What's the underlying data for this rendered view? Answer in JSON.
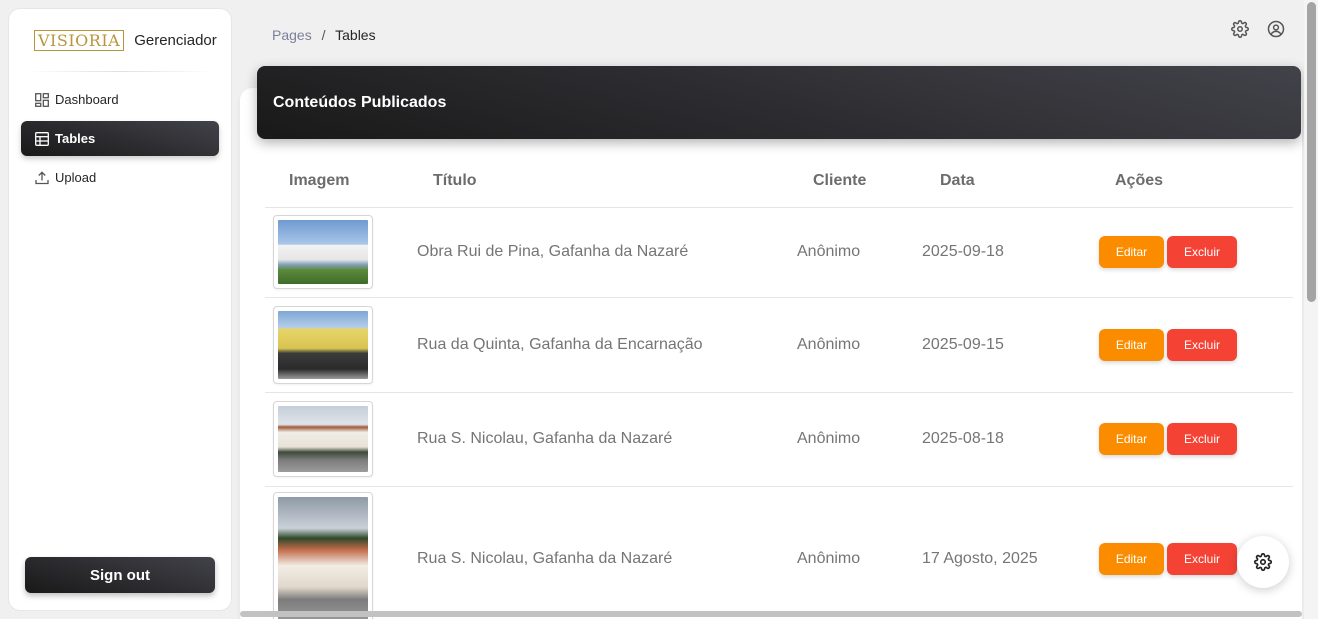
{
  "sidebar": {
    "logo_text": "VISIORIA",
    "brand_name": "Gerenciador",
    "items": [
      {
        "label": "Dashboard",
        "icon": "dashboard-icon",
        "active": false
      },
      {
        "label": "Tables",
        "icon": "table-icon",
        "active": true
      },
      {
        "label": "Upload",
        "icon": "upload-icon",
        "active": false
      }
    ],
    "signout_label": "Sign out"
  },
  "breadcrumb": {
    "root": "Pages",
    "separator": "/",
    "current": "Tables"
  },
  "header_icons": [
    "gear-icon",
    "account-icon"
  ],
  "card": {
    "title": "Conteúdos Publicados",
    "columns": {
      "image": "Imagem",
      "title": "Título",
      "client": "Cliente",
      "date": "Data",
      "actions": "Ações"
    },
    "edit_label": "Editar",
    "delete_label": "Excluir",
    "rows": [
      {
        "title": "Obra Rui de Pina, Gafanha da Nazaré",
        "client": "Anônimo",
        "date": "2025-09-18"
      },
      {
        "title": "Rua da Quinta, Gafanha da Encarnação",
        "client": "Anônimo",
        "date": "2025-09-15"
      },
      {
        "title": "Rua S. Nicolau, Gafanha da Nazaré",
        "client": "Anônimo",
        "date": "2025-08-18"
      },
      {
        "title": "Rua S. Nicolau, Gafanha da Nazaré",
        "client": "Anônimo",
        "date": "17 Agosto, 2025"
      }
    ]
  },
  "colors": {
    "edit": "#fb8c00",
    "delete": "#f44335",
    "dark": "#191919",
    "logo": "#b8963e"
  }
}
